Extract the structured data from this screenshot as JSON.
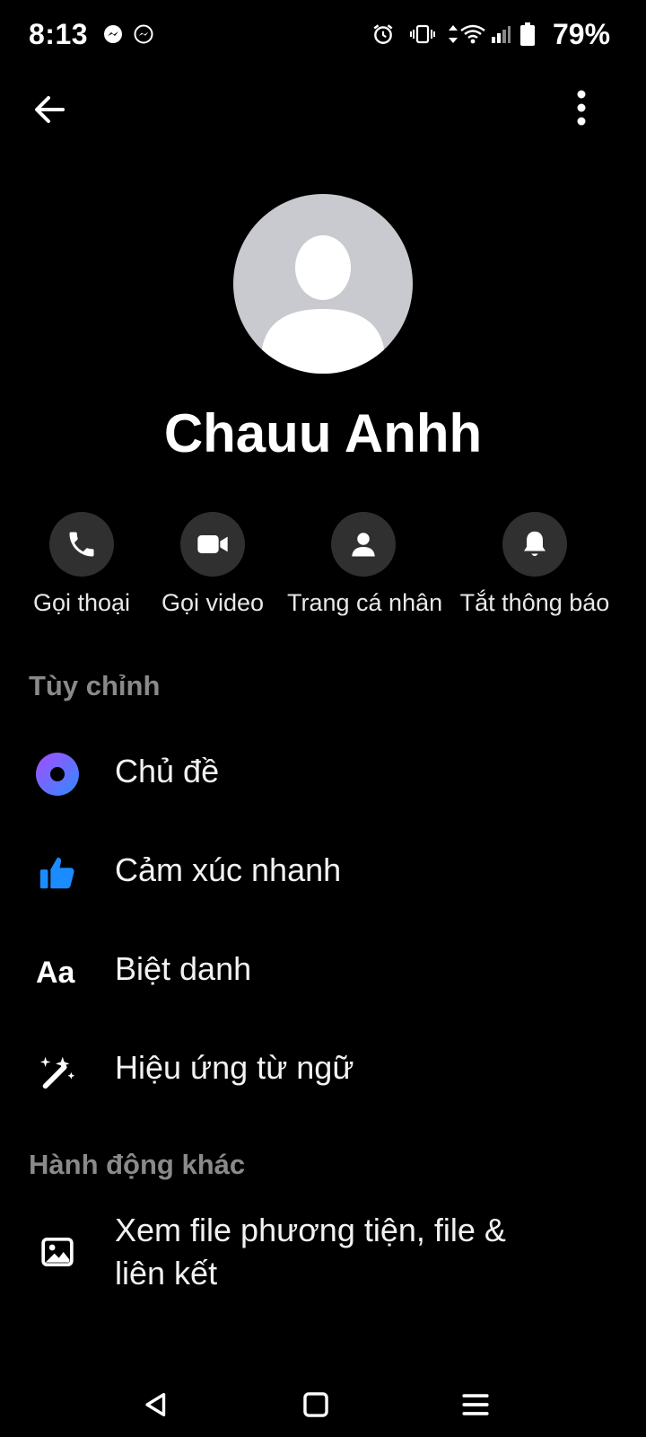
{
  "status_bar": {
    "time": "8:13",
    "battery": "79%",
    "icons": [
      "messenger-icon",
      "messenger-outline-icon",
      "alarm-icon",
      "vibrate-icon",
      "data-arrows-icon",
      "wifi-icon",
      "signal-icon",
      "battery-icon"
    ]
  },
  "header": {
    "icons": [
      "back-arrow-icon",
      "more-vertical-icon"
    ]
  },
  "profile": {
    "name": "Chauu Anhh",
    "avatar_color": "#c8cacf"
  },
  "actions": [
    {
      "label": "Gọi thoại",
      "icon": "phone-icon"
    },
    {
      "label": "Gọi video",
      "icon": "video-camera-icon"
    },
    {
      "label": "Trang cá nhân",
      "icon": "person-icon"
    },
    {
      "label": "Tắt thông báo",
      "icon": "bell-icon"
    }
  ],
  "sections": {
    "customize": {
      "title": "Tùy chỉnh",
      "items": [
        {
          "label": "Chủ đề",
          "icon": "theme-circle-icon"
        },
        {
          "label": "Cảm xúc nhanh",
          "icon": "thumbs-up-icon"
        },
        {
          "label": "Biệt danh",
          "icon": "nickname-aa-icon"
        },
        {
          "label": "Hiệu ứng từ ngữ",
          "icon": "magic-wand-icon"
        }
      ]
    },
    "more_actions": {
      "title": "Hành động khác",
      "items": [
        {
          "label_line1": "Xem file phương tiện, file &",
          "label_line2": "liên kết",
          "icon": "image-icon"
        }
      ]
    }
  },
  "nav": {
    "icons": [
      "back-triangle-icon",
      "home-square-icon",
      "recents-menu-icon"
    ]
  },
  "colors": {
    "background": "#000000",
    "accent": "#1a8cff",
    "section_title": "#8a8a8a",
    "action_circle": "#303030"
  }
}
